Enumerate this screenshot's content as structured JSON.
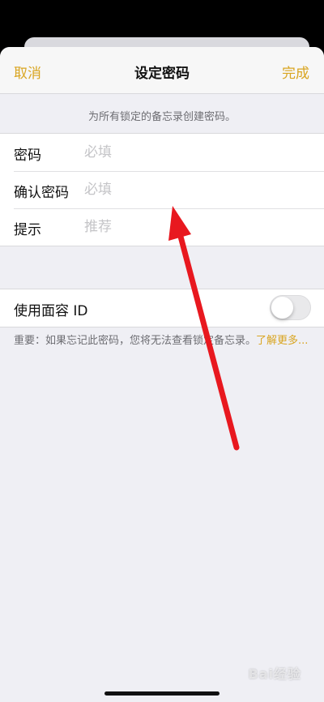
{
  "navbar": {
    "cancel_label": "取消",
    "title": "设定密码",
    "done_label": "完成"
  },
  "info_text": "为所有锁定的备忘录创建密码。",
  "password_fields": [
    {
      "label": "密码",
      "placeholder": "必填",
      "value": ""
    },
    {
      "label": "确认密码",
      "placeholder": "必填",
      "value": ""
    },
    {
      "label": "提示",
      "placeholder": "推荐",
      "value": ""
    }
  ],
  "face_id": {
    "label": "使用面容 ID",
    "enabled": false
  },
  "note": {
    "text": "重要：如果忘记此密码，您将无法查看锁定备忘录。",
    "link_text": "了解更多..."
  },
  "watermark": "Bai经验",
  "colors": {
    "accent": "#d9a521",
    "background": "#efeff4",
    "annotation_arrow": "#e8181f"
  }
}
